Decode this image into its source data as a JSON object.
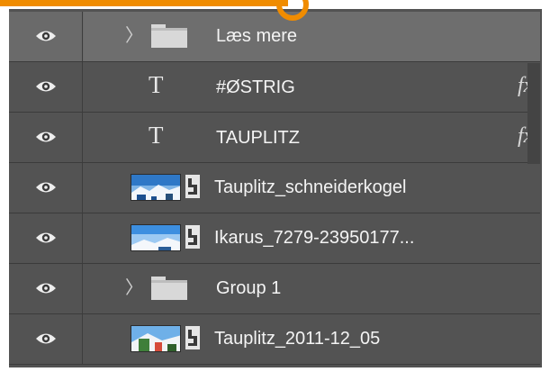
{
  "colors": {
    "panel_bg": "#535353",
    "selected_row_bg": "#6a6a6a",
    "annotation_accent": "#f08c00",
    "text": "#f4f4f4"
  },
  "layers": [
    {
      "name": "Læs mere",
      "kind": "group",
      "selected": true,
      "visible": true,
      "icon": "folder-icon"
    },
    {
      "name": "#ØSTRIG",
      "kind": "text",
      "visible": true,
      "effects": "fx",
      "icon": "text-layer-icon"
    },
    {
      "name": "TAUPLITZ",
      "kind": "text",
      "visible": true,
      "effects": "fx",
      "icon": "text-layer-icon"
    },
    {
      "name": "Tauplitz_schneiderkogel",
      "kind": "smart-object",
      "visible": true,
      "icon": "image-thumbnail"
    },
    {
      "name": "Ikarus_7279-23950177...",
      "kind": "smart-object",
      "visible": true,
      "icon": "image-thumbnail"
    },
    {
      "name": "Group 1",
      "kind": "group",
      "visible": true,
      "icon": "folder-icon"
    },
    {
      "name": "Tauplitz_2011-12_05",
      "kind": "smart-object",
      "visible": true,
      "icon": "image-thumbnail"
    }
  ]
}
